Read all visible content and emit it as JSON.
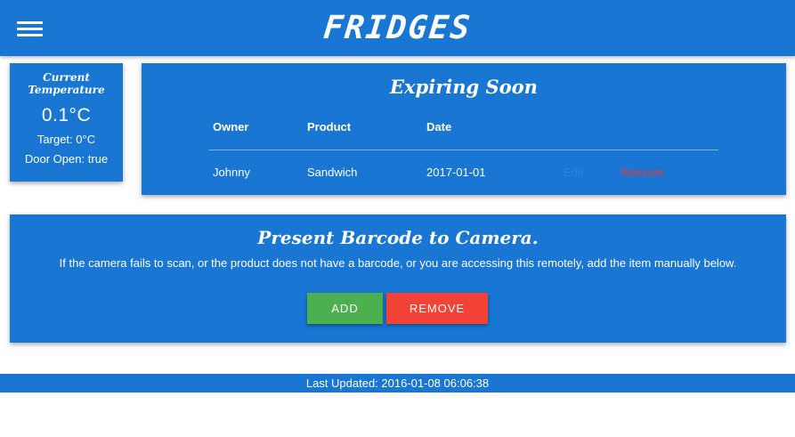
{
  "header": {
    "title": "FRIDGES",
    "menu_icon": "hamburger-menu-icon"
  },
  "temperature": {
    "title": "Current Temperature",
    "current": "0.1°C",
    "target": "Target: 0°C",
    "door": "Door Open: true"
  },
  "expiring": {
    "title": "Expiring Soon",
    "columns": [
      "Owner",
      "Product",
      "Date"
    ],
    "rows": [
      {
        "owner": "Johnny",
        "product": "Sandwich",
        "date": "2017-01-01",
        "edit_label": "Edit",
        "remove_label": "Remove"
      }
    ]
  },
  "barcode": {
    "title": "Present Barcode to Camera.",
    "instructions": "If the camera fails to scan, or the product does not have a barcode, or you are accessing this remotely, add the item manually below.",
    "add_label": "ADD",
    "remove_label": "REMOVE"
  },
  "footer": {
    "last_updated": "Last Updated: 2016-01-08 06:06:38"
  },
  "colors": {
    "primary": "#1976d2",
    "add": "#4caf50",
    "remove": "#f44336",
    "edit_link": "#1e88e5",
    "remove_link": "#e53935"
  }
}
